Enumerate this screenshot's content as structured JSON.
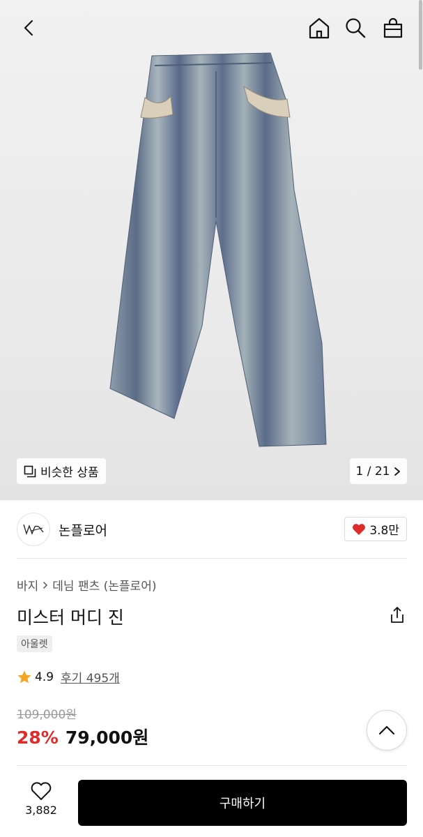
{
  "gallery": {
    "similar_label": "비슷한 상품",
    "counter": "1 / 21"
  },
  "brand": {
    "name": "논플로어",
    "likes": "3.8만"
  },
  "breadcrumb": {
    "category": "바지",
    "subcategory": "데님 팬츠 (논플로어)"
  },
  "product": {
    "title": "미스터 머디 진",
    "tag": "아울렛",
    "rating": "4.9",
    "reviews": "후기 495개",
    "original_price": "109,000원",
    "discount": "28%",
    "price": "79,000원"
  },
  "bottom": {
    "wish_count": "3,882",
    "buy_label": "구매하기"
  },
  "colors": {
    "accent_red": "#e02b2b",
    "star": "#f5a623",
    "buy_bg": "#000000"
  },
  "icons": [
    "back-icon",
    "home-icon",
    "search-icon",
    "bag-icon",
    "similar-icon",
    "chevron-right-icon",
    "heart-icon",
    "share-icon",
    "star-icon",
    "chevron-up-icon"
  ]
}
